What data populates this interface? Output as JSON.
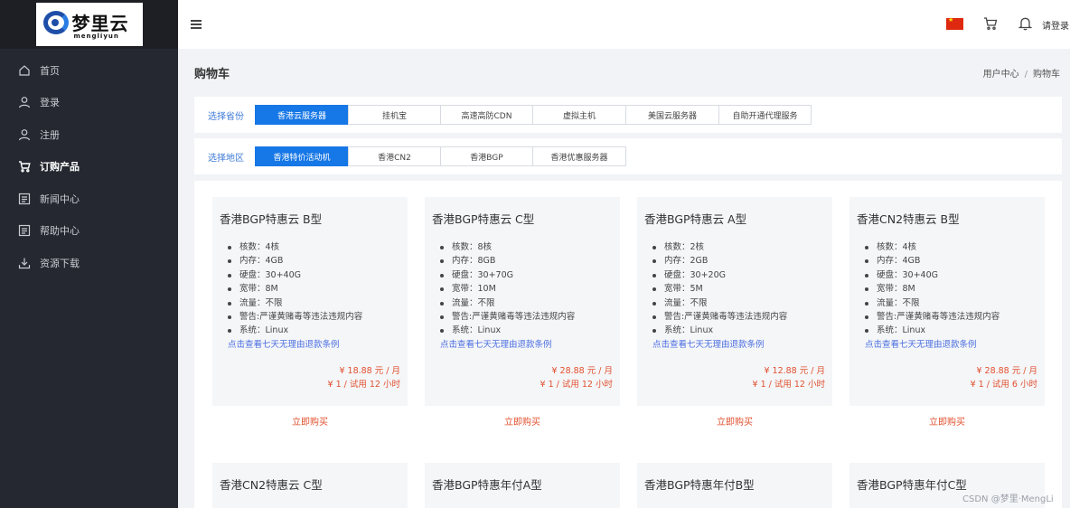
{
  "logo": {
    "cn": "梦里云",
    "en": "mengliyun"
  },
  "sidebar": {
    "items": [
      {
        "label": "首页",
        "icon": "home-icon"
      },
      {
        "label": "登录",
        "icon": "user-icon"
      },
      {
        "label": "注册",
        "icon": "user-icon"
      },
      {
        "label": "订购产品",
        "icon": "cart-icon",
        "active": true
      },
      {
        "label": "新闻中心",
        "icon": "news-icon"
      },
      {
        "label": "帮助中心",
        "icon": "help-icon"
      },
      {
        "label": "资源下载",
        "icon": "download-icon"
      }
    ]
  },
  "header": {
    "login": "请登录"
  },
  "page": {
    "title": "购物车",
    "breadcrumb": [
      "用户中心",
      "购物车"
    ]
  },
  "filters": {
    "province": {
      "label": "选择省份",
      "tabs": [
        "香港云服务器",
        "挂机宝",
        "高速高防CDN",
        "虚拟主机",
        "美国云服务器",
        "自助开通代理服务"
      ],
      "active": 0
    },
    "region": {
      "label": "选择地区",
      "tabs": [
        "香港特价活动机",
        "香港CN2",
        "香港BGP",
        "香港优惠服务器"
      ],
      "active": 0
    }
  },
  "products": [
    {
      "title": "香港BGP特惠云 B型",
      "specs": [
        "核数：4核",
        "内存：4GB",
        "硬盘：30+40G",
        "宽带：8M",
        "流量：不限",
        "警告:严谨黄赌毒等违法违规内容",
        "系统：Linux"
      ],
      "refund": "点击查看七天无理由退款条例",
      "price": "¥ 18.88 元 / 月",
      "trial": "¥ 1 / 试用 12 小时",
      "buy": "立即购买"
    },
    {
      "title": "香港BGP特惠云 C型",
      "specs": [
        "核数：8核",
        "内存：8GB",
        "硬盘：30+70G",
        "宽带：10M",
        "流量：不限",
        "警告:严谨黄赌毒等违法违规内容",
        "系统：Linux"
      ],
      "refund": "点击查看七天无理由退款条例",
      "price": "¥ 28.88 元 / 月",
      "trial": "¥ 1 / 试用 12 小时",
      "buy": "立即购买"
    },
    {
      "title": "香港BGP特惠云 A型",
      "specs": [
        "核数：2核",
        "内存：2GB",
        "硬盘：30+20G",
        "宽带：5M",
        "流量：不限",
        "警告:严谨黄赌毒等违法违规内容",
        "系统：Linux"
      ],
      "refund": "点击查看七天无理由退款条例",
      "price": "¥ 12.88 元 / 月",
      "trial": "¥ 1 / 试用 12 小时",
      "buy": "立即购买"
    },
    {
      "title": "香港CN2特惠云 B型",
      "specs": [
        "核数：4核",
        "内存：4GB",
        "硬盘：30+40G",
        "宽带：8M",
        "流量：不限",
        "警告:严谨黄赌毒等违法违规内容",
        "系统：Linux"
      ],
      "refund": "点击查看七天无理由退款条例",
      "price": "¥ 28.88 元 / 月",
      "trial": "¥ 1 / 试用 6 小时",
      "buy": "立即购买"
    },
    {
      "title": "香港CN2特惠云 C型"
    },
    {
      "title": "香港BGP特惠年付A型"
    },
    {
      "title": "香港BGP特惠年付B型"
    },
    {
      "title": "香港BGP特惠年付C型"
    }
  ],
  "watermark": "CSDN @梦里·MengLi",
  "colors": {
    "accent": "#1677e6",
    "price": "#e0502e",
    "sidebar": "#252830",
    "link": "#4a6ee0"
  }
}
